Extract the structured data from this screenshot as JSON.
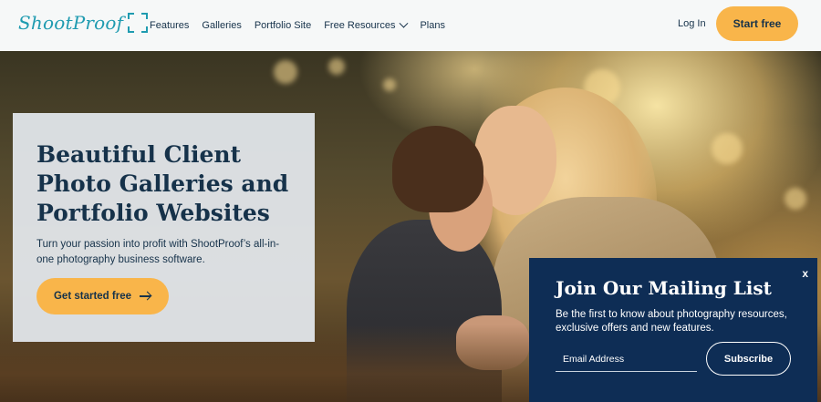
{
  "brand": {
    "logo_text": "ShootProof",
    "accent": "#1f9bb0",
    "cta_color": "#f9b54a",
    "navy": "#16324a",
    "panel_color": "#0e2d55"
  },
  "nav": {
    "items": [
      {
        "label": "Features"
      },
      {
        "label": "Galleries"
      },
      {
        "label": "Portfolio Site"
      },
      {
        "label": "Free Resources",
        "icon": "chevron-down-icon"
      },
      {
        "label": "Plans"
      }
    ],
    "login_label": "Log In",
    "start_label": "Start free"
  },
  "hero": {
    "title": "Beautiful Client Photo Galleries and Portfolio Websites",
    "subtitle": "Turn your passion into profit with ShootProof’s all-in-one photography business software.",
    "cta_label": "Get started free",
    "cta_icon": "arrow-right-icon"
  },
  "mailing": {
    "close_label": "x",
    "title": "Join Our Mailing List",
    "text": "Be the first to know about photography resources, exclusive offers and new features.",
    "email_placeholder": "Email Address",
    "subscribe_label": "Subscribe"
  }
}
